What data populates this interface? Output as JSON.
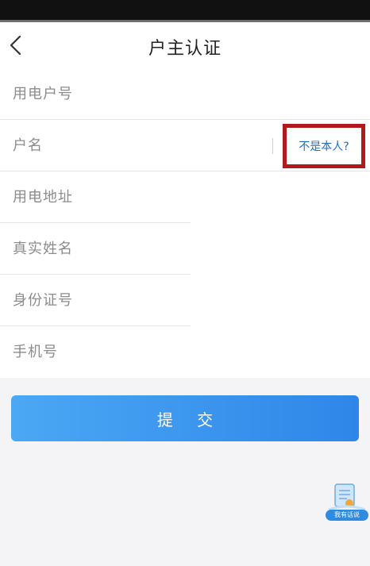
{
  "header": {
    "title": "户主认证",
    "back_icon": "chevron-left-icon"
  },
  "form": {
    "fields": [
      {
        "placeholder": "用电户号",
        "value": ""
      },
      {
        "placeholder": "户名",
        "value": ""
      },
      {
        "placeholder": "用电地址",
        "value": ""
      },
      {
        "placeholder": "真实姓名",
        "value": ""
      },
      {
        "placeholder": "身份证号",
        "value": ""
      },
      {
        "placeholder": "手机号",
        "value": ""
      }
    ],
    "not_me_link": "不是本人?"
  },
  "submit_label": "提 交",
  "help_widget": {
    "label": "我有话说",
    "icon": "feedback-chat-icon"
  },
  "colors": {
    "accent": "#2f86e8",
    "link": "#1e6fc2",
    "highlight_border": "#b01a1f"
  }
}
